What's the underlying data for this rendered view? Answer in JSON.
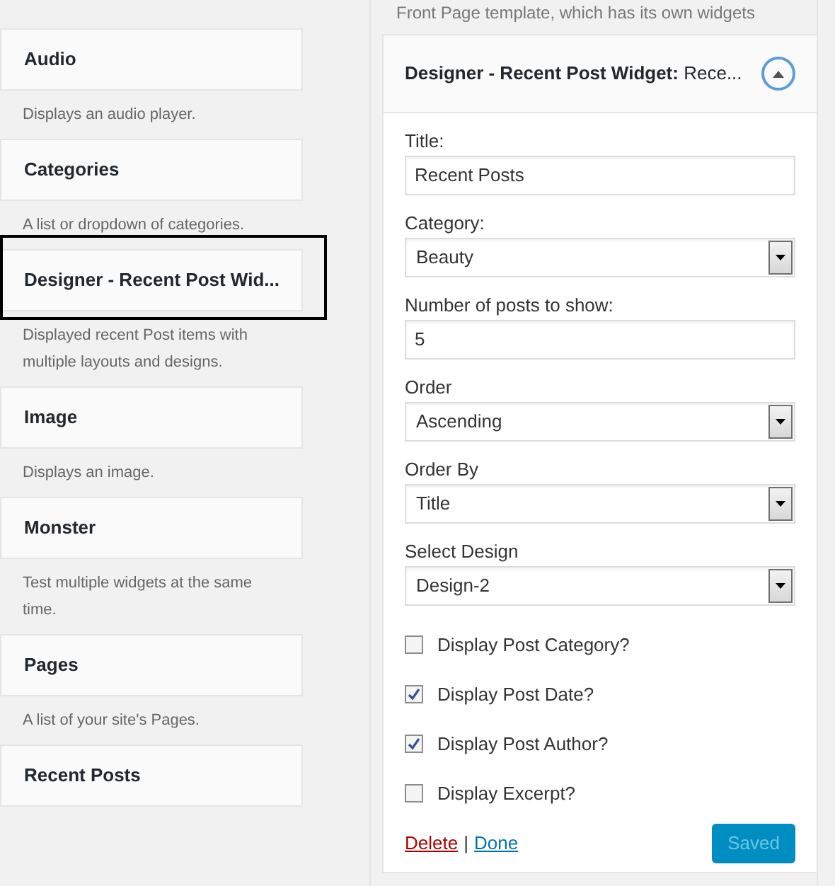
{
  "available_widgets": [
    {
      "name": "Audio",
      "description": "Displays an audio player.",
      "selected": false
    },
    {
      "name": "Categories",
      "description": "A list or dropdown of categories.",
      "selected": false
    },
    {
      "name": "Designer - Recent Post Wid...",
      "description": "Displayed recent Post items with multiple layouts and designs.",
      "selected": true
    },
    {
      "name": "Image",
      "description": "Displays an image.",
      "selected": false
    },
    {
      "name": "Monster",
      "description": "Test multiple widgets at the same time.",
      "selected": false
    },
    {
      "name": "Pages",
      "description": "A list of your site's Pages.",
      "selected": false
    },
    {
      "name": "Recent Posts",
      "selected": false
    }
  ],
  "sidebar_note": "Front Page template, which has its own widgets",
  "widget_panel": {
    "title": "Designer - Recent Post Widget:",
    "subtitle": "Rece...",
    "expanded": true,
    "fields": [
      {
        "kind": "text",
        "label": "Title:",
        "value": "Recent Posts"
      },
      {
        "kind": "select",
        "label": "Category:",
        "value": "Beauty"
      },
      {
        "kind": "text",
        "label": "Number of posts to show:",
        "value": "5"
      },
      {
        "kind": "select",
        "label": "Order",
        "value": "Ascending"
      },
      {
        "kind": "select",
        "label": "Order By",
        "value": "Title"
      },
      {
        "kind": "select",
        "label": "Select Design",
        "value": "Design-2"
      },
      {
        "kind": "checkbox",
        "label": "Display Post Category?",
        "checked": false
      },
      {
        "kind": "checkbox",
        "label": "Display Post Date?",
        "checked": true
      },
      {
        "kind": "checkbox",
        "label": "Display Post Author?",
        "checked": true
      },
      {
        "kind": "checkbox",
        "label": "Display Excerpt?",
        "checked": false
      }
    ],
    "delete_link": "Delete",
    "separator": "|",
    "done_link": "Done",
    "save_button": {
      "label": "Saved",
      "disabled": true
    }
  }
}
